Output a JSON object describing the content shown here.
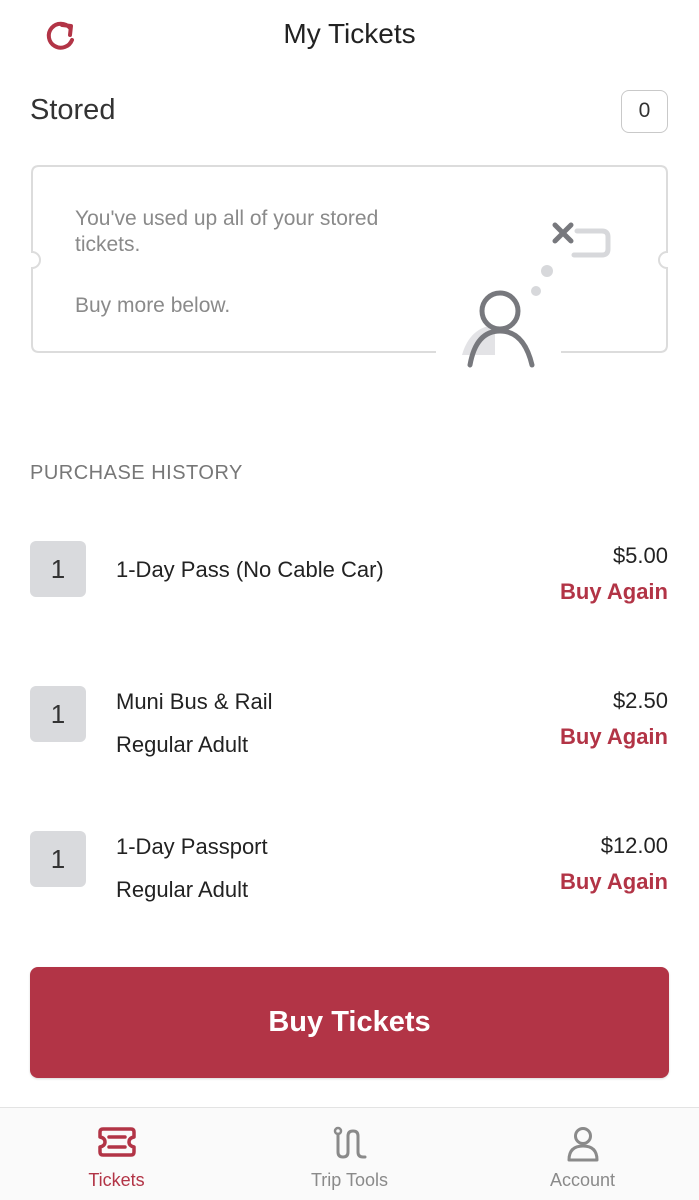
{
  "header": {
    "title": "My Tickets",
    "refresh_icon": "refresh-icon"
  },
  "stored": {
    "label": "Stored",
    "count": "0",
    "empty_message": "You've used up all of your stored tickets.",
    "empty_sub": "Buy more below."
  },
  "history": {
    "title": "PURCHASE HISTORY",
    "items": [
      {
        "qty": "1",
        "name": "1-Day Pass (No Cable Car)",
        "sub": "",
        "price": "$5.00",
        "action": "Buy Again"
      },
      {
        "qty": "1",
        "name": "Muni Bus & Rail",
        "sub": "Regular Adult",
        "price": "$2.50",
        "action": "Buy Again"
      },
      {
        "qty": "1",
        "name": "1-Day Passport",
        "sub": "Regular Adult",
        "price": "$12.00",
        "action": "Buy Again"
      }
    ]
  },
  "buy_button": {
    "label": "Buy Tickets"
  },
  "tabs": [
    {
      "label": "Tickets",
      "icon": "ticket-icon",
      "active": true
    },
    {
      "label": "Trip Tools",
      "icon": "route-icon",
      "active": false
    },
    {
      "label": "Account",
      "icon": "person-icon",
      "active": false
    }
  ],
  "colors": {
    "accent": "#b23446",
    "muted_text": "#8a8a8a",
    "qty_background": "#d9dadd"
  }
}
